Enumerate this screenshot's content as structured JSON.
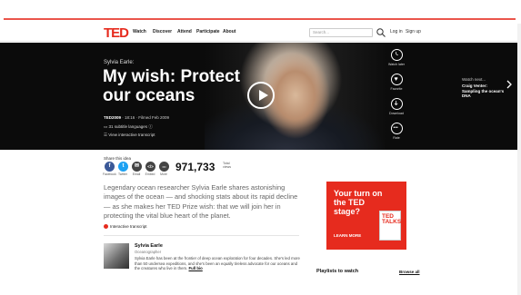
{
  "nav": {
    "logo": "TED",
    "links": [
      "Watch",
      "Discover",
      "Attend",
      "Participate",
      "About"
    ],
    "search_placeholder": "Search...",
    "login": "Log in",
    "signup": "Sign up"
  },
  "hero": {
    "speaker": "Sylvia Earle:",
    "title": "My wish: Protect our oceans",
    "meta_event": "TED2009",
    "meta_duration": " · 18:16 · ",
    "meta_filmed": "Filmed Feb 2009",
    "subtitles": "31 subtitle languages",
    "transcript": "View interactive transcript",
    "actions": [
      {
        "label": "Watch later",
        "icon": "clock-icon"
      },
      {
        "label": "Favorite",
        "icon": "heart-icon"
      },
      {
        "label": "Download",
        "icon": "download-icon"
      },
      {
        "label": "Rate",
        "icon": "dots-icon"
      }
    ],
    "watch_next_label": "Watch next...",
    "watch_next_title": "Craig Venter: Sampling the ocean's DNA"
  },
  "share": {
    "title": "Share this idea",
    "items": [
      {
        "label": "Facebook",
        "glyph": "f",
        "color": "#3b5998"
      },
      {
        "label": "Twitter",
        "glyph": "t",
        "color": "#1da1f2"
      },
      {
        "label": "Email",
        "glyph": "✉",
        "color": "#444444"
      },
      {
        "label": "Embed",
        "glyph": "</>",
        "color": "#444444"
      },
      {
        "label": "More",
        "glyph": "•••",
        "color": "#444444"
      }
    ],
    "views": "971,733",
    "views_label": "Total views"
  },
  "description": "Legendary ocean researcher Sylvia Earle shares astonishing images of the ocean — and shocking stats about its rapid decline — as she makes her TED Prize wish: that we will join her in protecting the vital blue heart of the planet.",
  "interactive_transcript": "Interactive transcript",
  "bio": {
    "name": "Sylvia Earle",
    "role": "Oceanographer",
    "text": "Sylvia Earle has been at the frontier of deep ocean exploration for four decades. She's led more than 50 undersea expeditions, and she's been an equally tireless advocate for our oceans and the creatures who live in them.",
    "more": "Full bio"
  },
  "ad": {
    "headline": "Your turn on the TED stage?",
    "button": "LEARN MORE",
    "book": "TED TALKS"
  },
  "playlists": {
    "title": "Playlists to watch",
    "browse": "Browse all"
  },
  "colors": {
    "brand_red": "#e62b1e",
    "hero_bg": "#0b0b0b"
  }
}
